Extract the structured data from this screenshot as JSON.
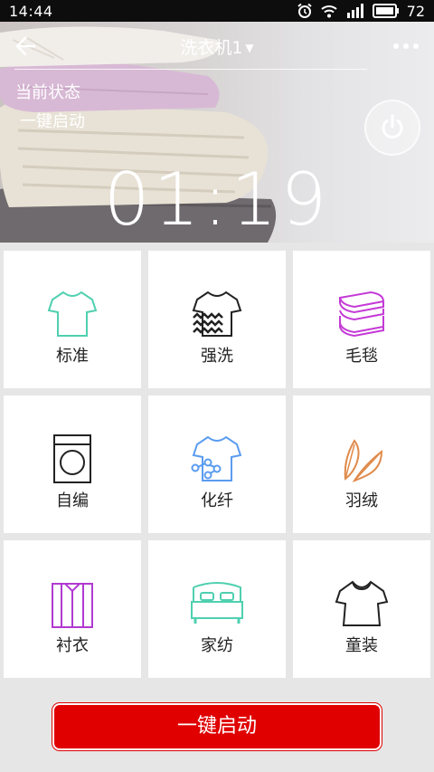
{
  "status_bar": {
    "time": "14:44",
    "battery_percent": "72",
    "icons": [
      "alarm-icon",
      "wifi-icon",
      "signal-icon",
      "battery-icon"
    ]
  },
  "header": {
    "title": "洗衣机1",
    "back_icon": "arrow-left-icon",
    "more_icon": "more-dots-icon",
    "dropdown_icon": "caret-down-icon"
  },
  "state": {
    "label": "当前状态",
    "value": "一键启动",
    "timer": "01:19",
    "power_icon": "power-icon"
  },
  "programs": [
    {
      "label": "标准",
      "icon": "tshirt-icon",
      "color": "#4fd0b0"
    },
    {
      "label": "强洗",
      "icon": "tshirt-waves-icon",
      "color": "#222222"
    },
    {
      "label": "毛毯",
      "icon": "blanket-icon",
      "color": "#c43ad6"
    },
    {
      "label": "自编",
      "icon": "washer-icon",
      "color": "#222222"
    },
    {
      "label": "化纤",
      "icon": "tshirt-molecule-icon",
      "color": "#5b9cf0"
    },
    {
      "label": "羽绒",
      "icon": "feather-icon",
      "color": "#e08a4a"
    },
    {
      "label": "衬衣",
      "icon": "shirt-icon",
      "color": "#b13bd1"
    },
    {
      "label": "家纺",
      "icon": "bed-icon",
      "color": "#4fd0b0"
    },
    {
      "label": "童装",
      "icon": "kids-dress-icon",
      "color": "#222222"
    }
  ],
  "start_button": {
    "label": "一键启动",
    "color": "#e00000"
  }
}
